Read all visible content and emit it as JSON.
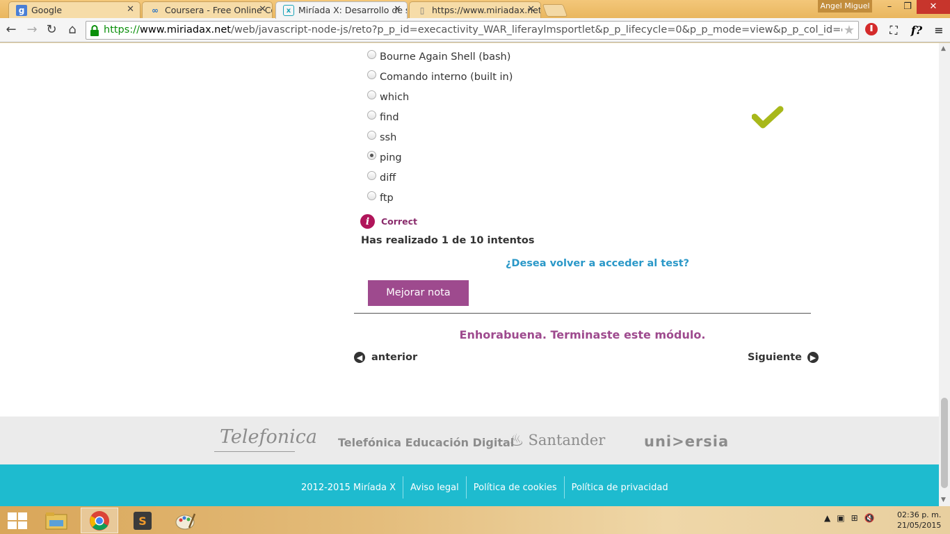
{
  "browser": {
    "tabs": [
      {
        "title": "Google",
        "icon": "google-favicon"
      },
      {
        "title": "Coursera - Free Online Co",
        "icon": "coursera-favicon"
      },
      {
        "title": "Miríada X: Desarrollo de s",
        "icon": "miriadax-favicon",
        "active": true
      },
      {
        "title": "https://www.miriadax.net/",
        "icon": "page-favicon"
      }
    ],
    "user": "Angel Miguel",
    "url": {
      "scheme": "https://",
      "host": "www.miriadax.net",
      "path": "/web/javascript-node-js/reto?p_p_id=execactivity_WAR_liferaylmsportlet&p_p_lifecycle=0&p_p_mode=view&p_p_col_id=colu"
    }
  },
  "quiz": {
    "options": [
      {
        "label": "Bourne Again Shell (bash)",
        "checked": false
      },
      {
        "label": "Comando interno (built in)",
        "checked": false
      },
      {
        "label": "which",
        "checked": false
      },
      {
        "label": "find",
        "checked": false
      },
      {
        "label": "ssh",
        "checked": false
      },
      {
        "label": "ping",
        "checked": true
      },
      {
        "label": "diff",
        "checked": false
      },
      {
        "label": "ftp",
        "checked": false
      }
    ],
    "result_icon": "checkmark-icon",
    "feedback": "Correct",
    "attempts": "Has realizado 1 de 10 intentos",
    "retry_link": "¿Desea volver a acceder al test?",
    "improve_button": "Mejorar nota",
    "congrats": "Enhorabuena. Terminaste este módulo.",
    "prev_label": "anterior",
    "next_label": "Siguiente"
  },
  "sponsors": {
    "telefonica": "Telefonica",
    "ted": "Telefónica Educación Digital",
    "santander": "Santander",
    "universia": "uni>ersia"
  },
  "footer": {
    "links": [
      "2012-2015 Miríada X",
      "Aviso legal",
      "Política de cookies",
      "Política de privacidad"
    ]
  },
  "taskbar": {
    "time": "02:36 p. m.",
    "date": "21/05/2015"
  },
  "colors": {
    "accent_purple": "#9e4a8e",
    "footer_cyan": "#1ebbcf",
    "check_green": "#a8b81a",
    "link_blue": "#2a98c8"
  }
}
